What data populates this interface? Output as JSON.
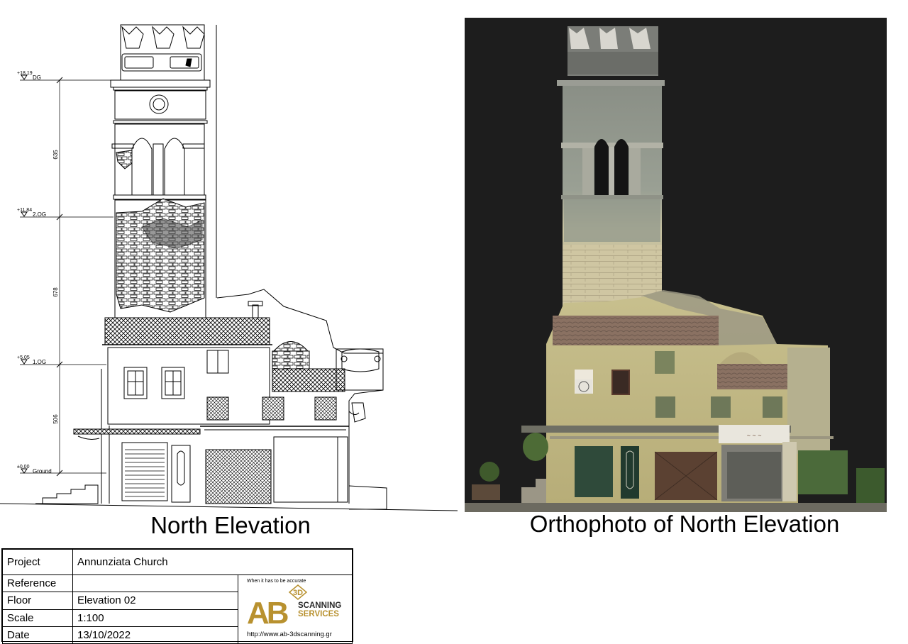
{
  "drawing": {
    "levels": [
      {
        "value": "+18,19",
        "name": "DG"
      },
      {
        "value": "+11,84",
        "name": "2.OG"
      },
      {
        "value": "+5,05",
        "name": "1.OG"
      },
      {
        "value": "±0,00",
        "name": "Ground"
      }
    ],
    "dimensions": [
      "635",
      "678",
      "506"
    ]
  },
  "captions": {
    "left": "North Elevation",
    "right": "Orthophoto of North Elevation"
  },
  "title_block": {
    "project_label": "Project",
    "project_value": "Annunziata Church",
    "reference_label": "Reference",
    "reference_value": "",
    "floor_label": "Floor",
    "floor_value": "Elevation 02",
    "scale_label": "Scale",
    "scale_value": "1:100",
    "date_label": "Date",
    "date_value": "13/10/2022"
  },
  "logo": {
    "tagline": "When it has to be accurate",
    "letters": "AB",
    "three_d": "3D",
    "line1": "SCANNING",
    "line2": "SERVICES",
    "url": "http://www.ab-3dscanning.gr",
    "colors": {
      "gold": "#b8912f",
      "dark": "#2b2b2b"
    }
  }
}
